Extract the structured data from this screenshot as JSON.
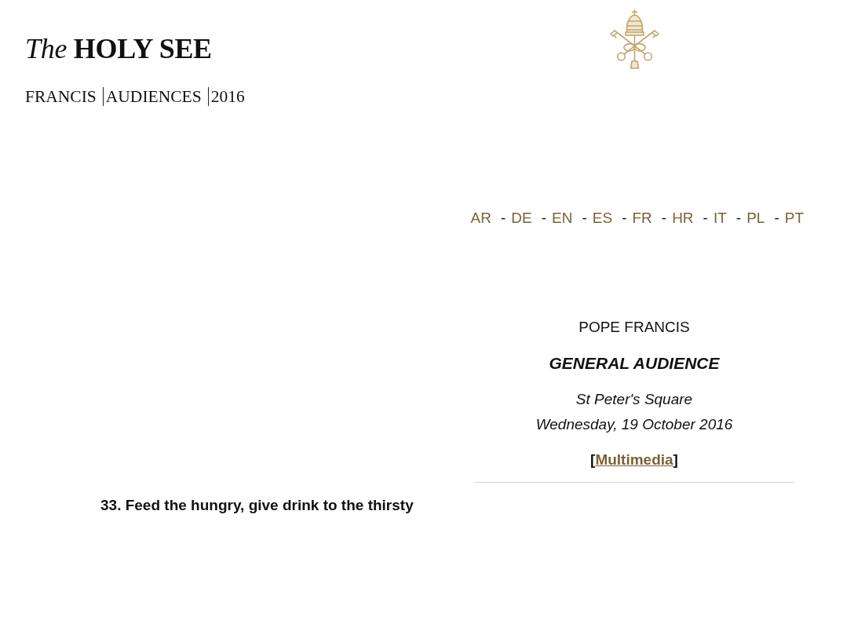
{
  "header": {
    "logo": "*The* HOLY SEE",
    "breadcrumb": [
      "FRANCIS",
      "AUDIENCES",
      "2016"
    ]
  },
  "languages": {
    "separator": "-",
    "items": [
      "AR",
      "DE",
      "EN",
      "ES",
      "FR",
      "HR",
      "IT",
      "PL",
      "PT"
    ]
  },
  "intro": {
    "author": "POPE FRANCIS",
    "event": "GENERAL AUDIENCE",
    "place": "St Peter's Square",
    "date": "Wednesday, 19 October 2016",
    "multimedia": {
      "before": "[",
      "link": "Multimedia",
      "after": "]"
    }
  },
  "title": "33. Feed the hungry, give drink to the thirsty"
}
